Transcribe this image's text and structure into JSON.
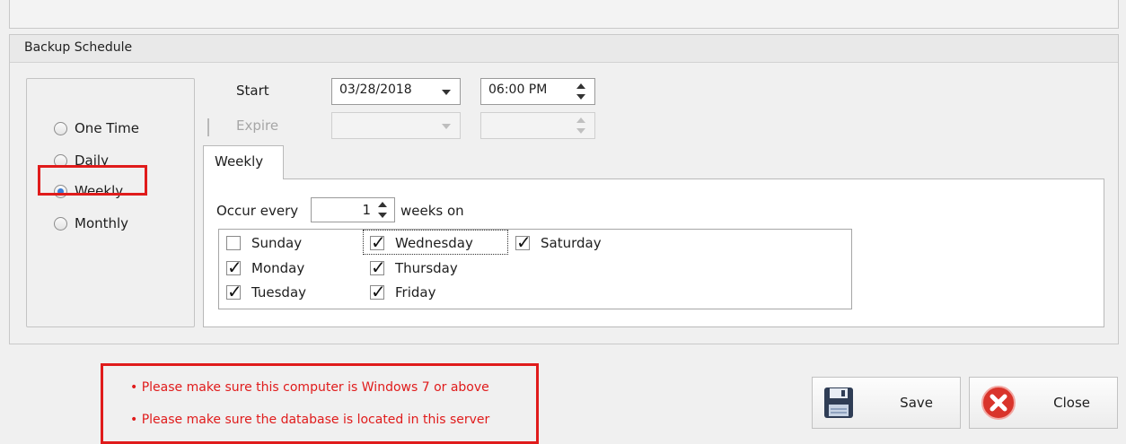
{
  "group": {
    "title": "Backup Schedule"
  },
  "frequency": {
    "options": [
      {
        "label": "One Time",
        "checked": false
      },
      {
        "label": "Daily",
        "checked": false
      },
      {
        "label": "Weekly",
        "checked": true
      },
      {
        "label": "Monthly",
        "checked": false
      }
    ]
  },
  "start": {
    "label": "Start",
    "date": "03/28/2018",
    "time": "06:00 PM"
  },
  "expire": {
    "label": "Expire",
    "checked": false,
    "date": "",
    "time": ""
  },
  "tabs": [
    {
      "label": "Weekly"
    }
  ],
  "weekly": {
    "occur_label": "Occur every",
    "interval": "1",
    "suffix": "weeks on",
    "days": [
      {
        "label": "Sunday",
        "checked": false
      },
      {
        "label": "Monday",
        "checked": true
      },
      {
        "label": "Tuesday",
        "checked": true
      },
      {
        "label": "Wednesday",
        "checked": true
      },
      {
        "label": "Thursday",
        "checked": true
      },
      {
        "label": "Friday",
        "checked": true
      },
      {
        "label": "Saturday",
        "checked": true
      }
    ]
  },
  "notes": [
    "Please make sure this computer is Windows 7 or above",
    "Please make sure the database is located in this server"
  ],
  "buttons": {
    "save": {
      "label": "Save",
      "icon": "floppy-disk-icon"
    },
    "close": {
      "label": "Close",
      "icon": "close-circle-icon"
    }
  },
  "colors": {
    "highlight": "#e01b1b",
    "radio_selected": "#3a7bd5",
    "close_icon": "#d9342b",
    "save_icon": "#2f3d55"
  }
}
